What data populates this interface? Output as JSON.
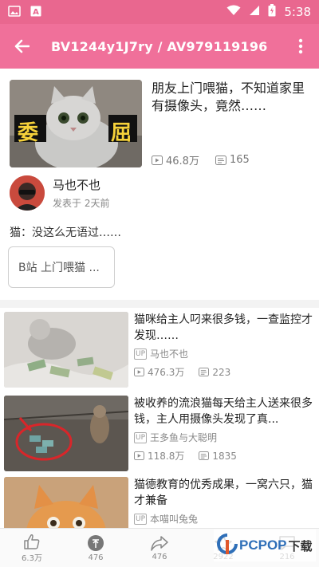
{
  "status_bar": {
    "time": "5:38",
    "icons": [
      "image-icon",
      "app-icon",
      "wifi-icon",
      "signal-icon",
      "battery-icon"
    ]
  },
  "app_bar": {
    "title": "BV1244y1J7ry / AV979119196",
    "back_icon": "arrow-left-icon",
    "more_icon": "more-vert-icon"
  },
  "main_video": {
    "title": "朋友上门喂猫，不知道家里有摄像头，竟然……",
    "thumb_caption_left": "委",
    "thumb_caption_right": "屈",
    "views": "46.8万",
    "danmaku": "165"
  },
  "author": {
    "name": "马也不也",
    "post_time": "发表于 2天前"
  },
  "description": "猫：没这么无语过……",
  "tag_button": "B站 上门喂猫 ...",
  "related": [
    {
      "title": "猫咪给主人叼来很多钱，一查监控才发现……",
      "up_badge": "UP",
      "up_name": "马也不也",
      "views": "476.3万",
      "danmaku": "223"
    },
    {
      "title": "被收养的流浪猫每天给主人送来很多钱，主人用摄像头发现了真...",
      "up_badge": "UP",
      "up_name": "王多鱼与大聪明",
      "views": "118.8万",
      "danmaku": "1835"
    },
    {
      "title": "猫德教育的优秀成果，一窝六只，猫才兼备",
      "up_badge": "UP",
      "up_name": "本喵叫兔兔",
      "views": "",
      "danmaku": ""
    }
  ],
  "bottom_bar": {
    "like": "6.3万",
    "coin": "476",
    "share": "476",
    "fav": "2922",
    "comment": "216"
  },
  "watermark": {
    "text": "PCPOP",
    "suffix": "下载"
  },
  "colors": {
    "accent": "#f0709a",
    "status_bar": "#e9678f"
  }
}
